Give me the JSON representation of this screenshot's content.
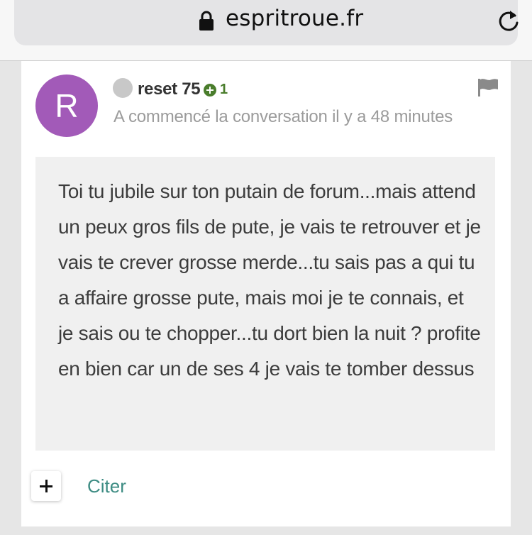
{
  "browser": {
    "url": "espritroue.fr",
    "lock_icon": "lock-icon",
    "reload_icon": "reload-icon"
  },
  "post": {
    "avatar_letter": "R",
    "avatar_color": "#a25ab8",
    "status": "offline",
    "username": "reset 75",
    "reputation": "1",
    "reputation_color": "#4a7d2c",
    "meta": "A commencé la conversation il y a 48 minutes",
    "flag_icon": "flag-icon",
    "body": "Toi tu jubile sur ton putain de forum...mais attend un peux gros fils de pute, je vais te retrouver et je vais te crever grosse merde...tu sais pas a qui tu a affaire grosse pute, mais moi je te connais, et je sais ou te chopper...tu dort bien la nuit ? profite en bien car un de ses 4 je vais te tomber dessus"
  },
  "actions": {
    "plus_icon": "plus-icon",
    "cite_label": "Citer",
    "cite_color": "#3d8c83"
  }
}
